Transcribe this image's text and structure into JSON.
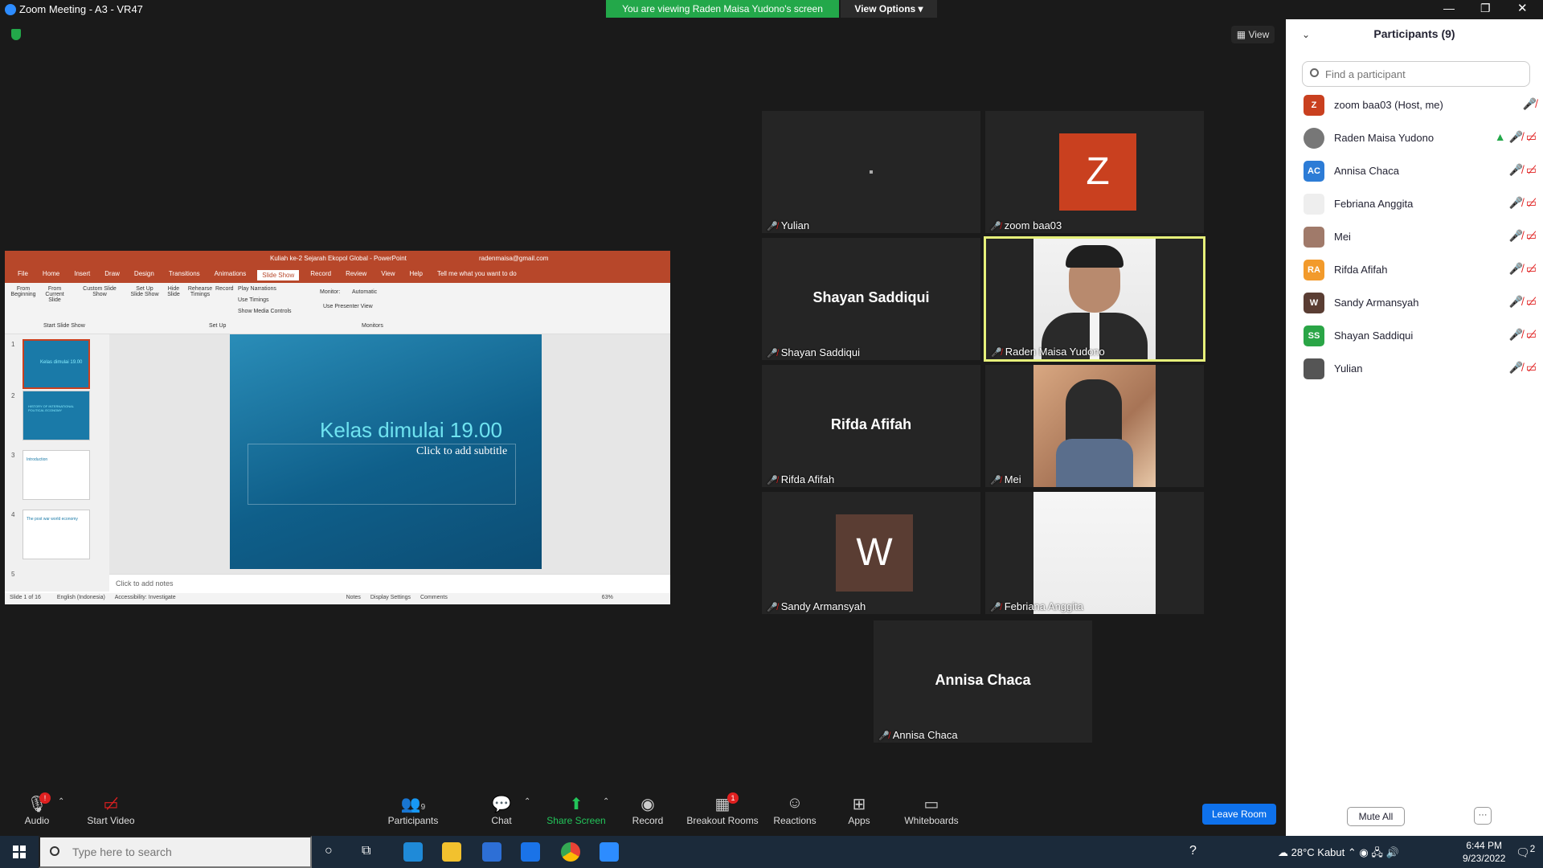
{
  "window": {
    "title": "Zoom Meeting - A3 - VR47"
  },
  "banner": {
    "viewing": "You are viewing Raden Maisa Yudono's screen",
    "view_options": "View Options"
  },
  "view_button": "View",
  "shared": {
    "app_title": "Kuliah ke-2 Sejarah Ekopol Global  -  PowerPoint",
    "account": "radenmaisa@gmail.com",
    "tabs": [
      "File",
      "Home",
      "Insert",
      "Draw",
      "Design",
      "Transitions",
      "Animations",
      "Slide Show",
      "Record",
      "Review",
      "View",
      "Help"
    ],
    "tell_me": "Tell me what you want to do",
    "ribbon": {
      "from_beginning": "From Beginning",
      "from_current": "From Current Slide",
      "custom": "Custom Slide Show",
      "start_group": "Start Slide Show",
      "setup": "Set Up Slide Show",
      "hide": "Hide Slide",
      "rehearse": "Rehearse Timings",
      "record": "Record",
      "play_narr": "Play Narrations",
      "use_timings": "Use Timings",
      "show_media": "Show Media Controls",
      "setup_group": "Set Up",
      "monitor": "Monitor:",
      "monitor_val": "Automatic",
      "presenter": "Use Presenter View",
      "monitors_group": "Monitors"
    },
    "thumbs": [
      {
        "num": "1",
        "title": "Kelas dimulai 19.00"
      },
      {
        "num": "2",
        "title": "HISTORY OF INTERNATIONAL POLITICAL ECONOMY"
      },
      {
        "num": "3",
        "title": "Introduction"
      },
      {
        "num": "4",
        "title": "The post war world economy"
      },
      {
        "num": "5",
        "title": ""
      }
    ],
    "slide_title": "Kelas dimulai 19.00",
    "slide_subtitle": "Click to add subtitle",
    "notes": "Click to add notes",
    "status_left": "Slide 1 of 16",
    "status_lang": "English (Indonesia)",
    "status_access": "Accessibility: Investigate",
    "status_notes": "Notes",
    "status_display": "Display Settings",
    "status_comments": "Comments",
    "status_zoom": "63%"
  },
  "tiles": [
    {
      "name": "Yulian",
      "kind": "dot"
    },
    {
      "name": "zoom baa03",
      "kind": "avatar",
      "letter": "Z",
      "color": "#c9401f"
    },
    {
      "name": "Shayan Saddiqui",
      "kind": "text"
    },
    {
      "name": "Raden Maisa Yudono",
      "kind": "photo-man"
    },
    {
      "name": "Rifda Afifah",
      "kind": "text"
    },
    {
      "name": "Mei",
      "kind": "photo-woman"
    },
    {
      "name": "Sandy Armansyah",
      "kind": "avatar",
      "letter": "W",
      "color": "#5a3d33"
    },
    {
      "name": "Febriana Anggita",
      "kind": "photo-blank"
    },
    {
      "name": "Annisa Chaca",
      "kind": "text"
    }
  ],
  "participants": {
    "header": "Participants (9)",
    "search_placeholder": "Find a participant",
    "list": [
      {
        "initials": "Z",
        "name": "zoom baa03 (Host, me)",
        "color": "#c9401f",
        "video_off": false,
        "sharing": false
      },
      {
        "initials": "",
        "name": "Raden Maisa Yudono",
        "color": "#777777",
        "video_off": true,
        "sharing": true
      },
      {
        "initials": "AC",
        "name": "Annisa Chaca",
        "color": "#2d7cd6",
        "video_off": true,
        "sharing": false
      },
      {
        "initials": "",
        "name": "Febriana Anggita",
        "color": "#eeeeee",
        "video_off": true,
        "sharing": false
      },
      {
        "initials": "",
        "name": "Mei",
        "color": "#a07a6a",
        "video_off": true,
        "sharing": false
      },
      {
        "initials": "RA",
        "name": "Rifda Afifah",
        "color": "#f29a2b",
        "video_off": true,
        "sharing": false
      },
      {
        "initials": "W",
        "name": "Sandy Armansyah",
        "color": "#5a3d33",
        "video_off": true,
        "sharing": false
      },
      {
        "initials": "SS",
        "name": "Shayan Saddiqui",
        "color": "#2aa546",
        "video_off": true,
        "sharing": false
      },
      {
        "initials": "",
        "name": "Yulian",
        "color": "#555555",
        "video_off": true,
        "sharing": false
      }
    ],
    "mute_all": "Mute All",
    "more": "···"
  },
  "toolbar": {
    "audio": "Audio",
    "audio_badge": "!",
    "start_video": "Start Video",
    "participants": "Participants",
    "participants_count": "9",
    "chat": "Chat",
    "share_screen": "Share Screen",
    "record": "Record",
    "breakout": "Breakout Rooms",
    "breakout_badge": "1",
    "reactions": "Reactions",
    "apps": "Apps",
    "whiteboards": "Whiteboards",
    "leave": "Leave Room"
  },
  "taskbar": {
    "search_placeholder": "Type here to search",
    "weather": "28°C  Kabut",
    "time": "6:44 PM",
    "date": "9/23/2022",
    "notif": "2"
  }
}
